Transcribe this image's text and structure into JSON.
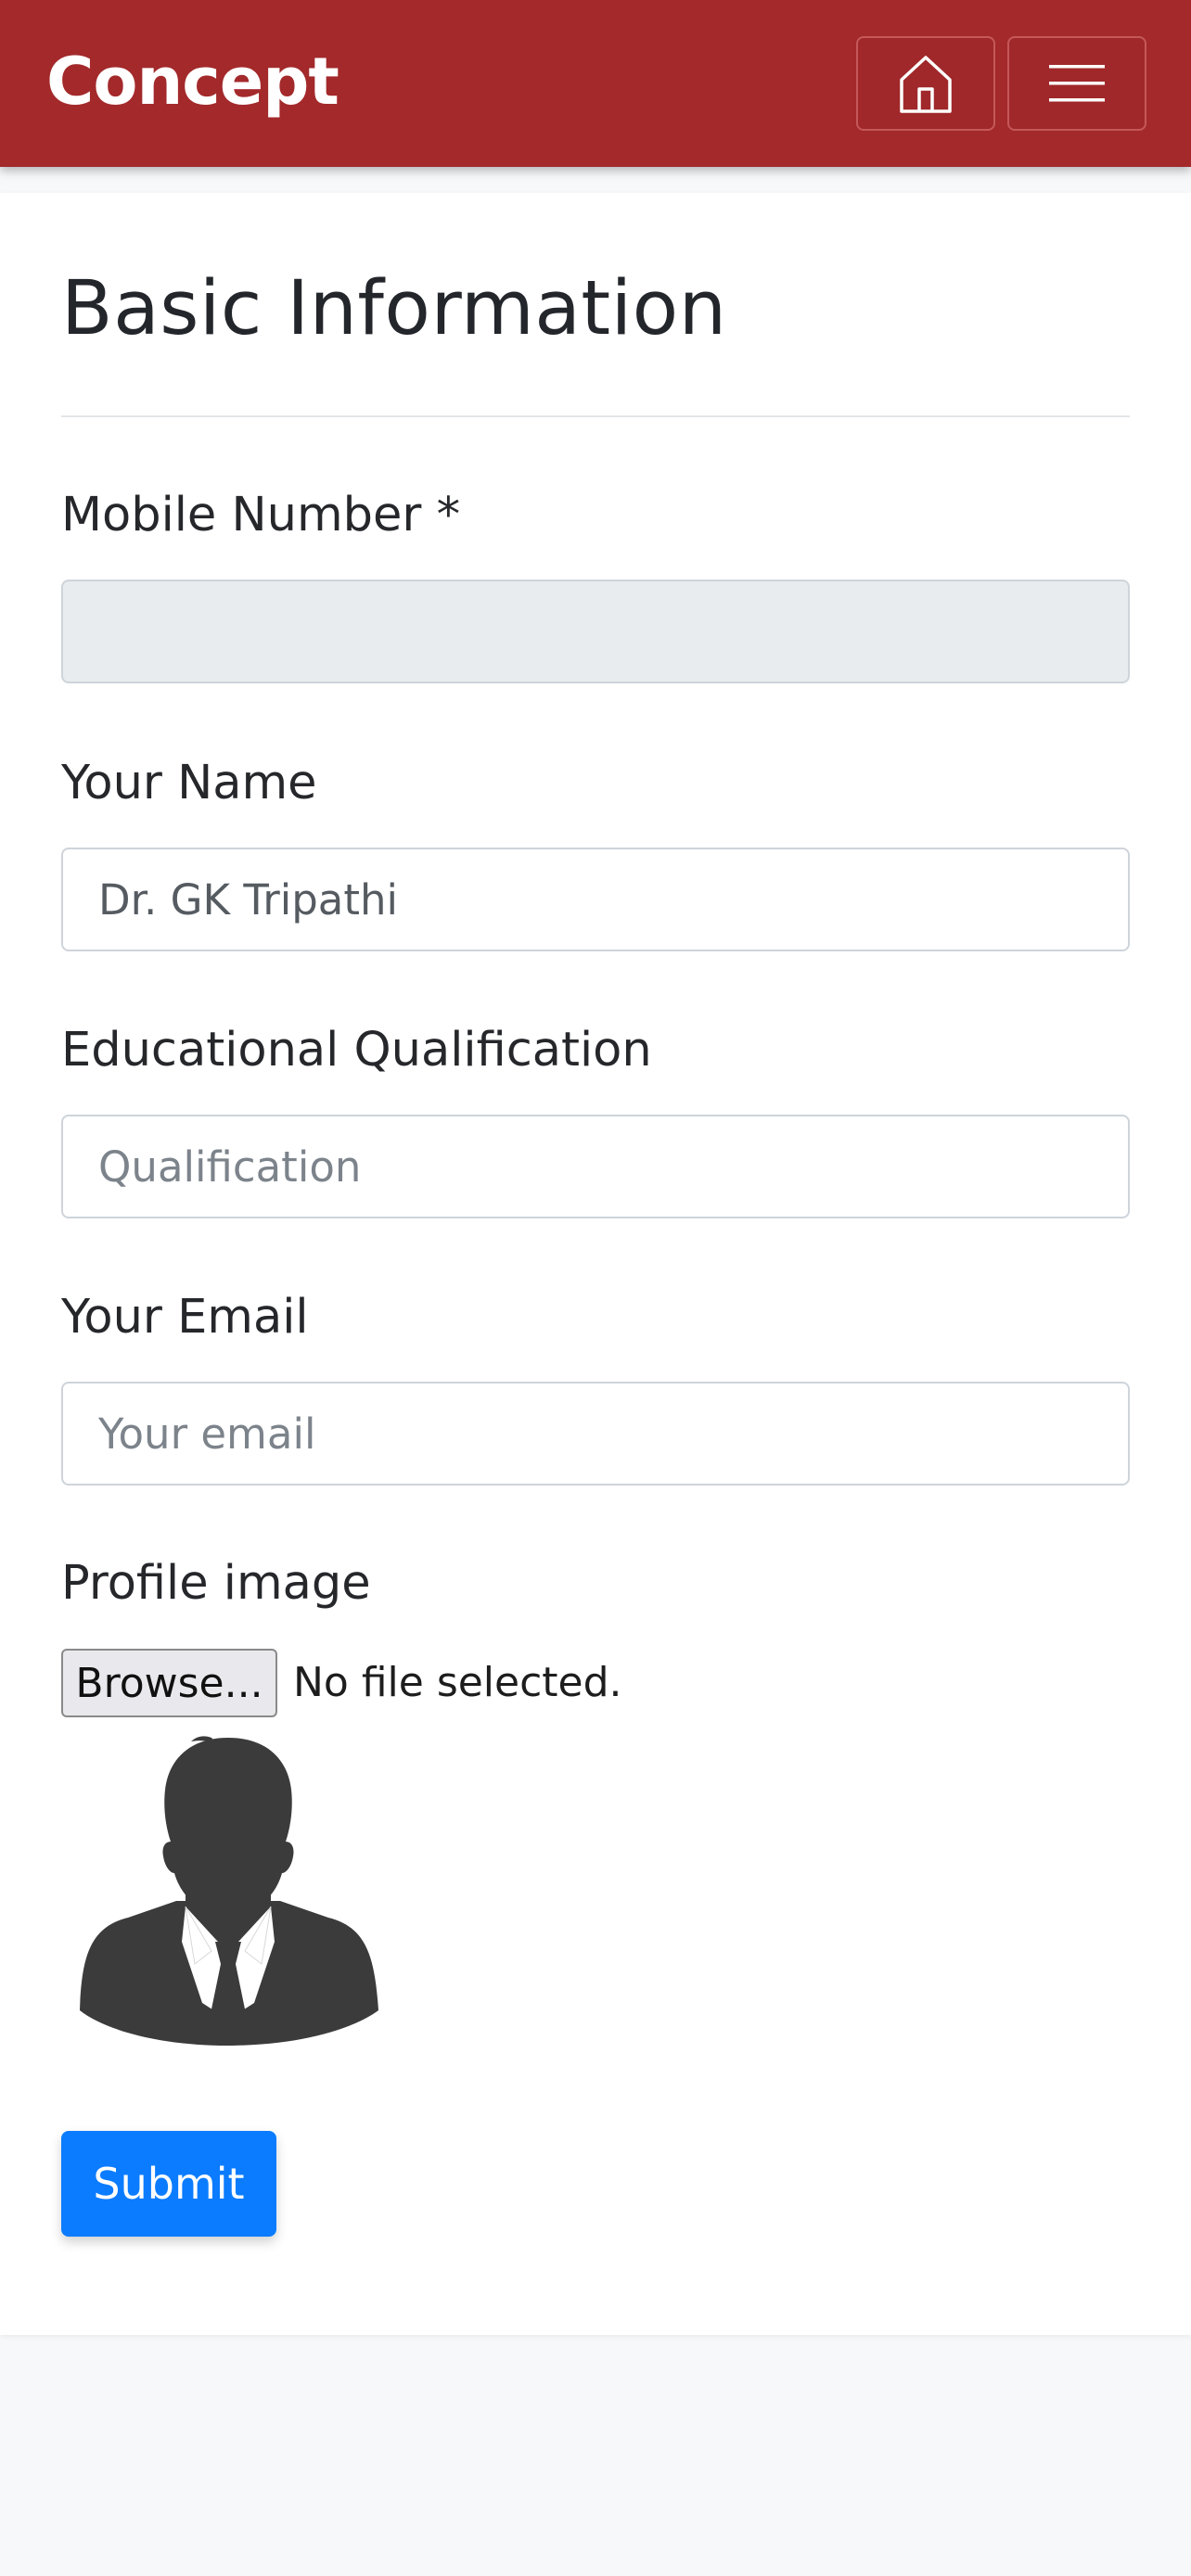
{
  "header": {
    "brand": "Concept",
    "home_icon": "home-icon",
    "menu_icon": "hamburger-menu-icon"
  },
  "form": {
    "title": "Basic Information",
    "mobile": {
      "label": "Mobile Number *",
      "value": ""
    },
    "name": {
      "label": "Your Name",
      "value": "Dr. GK Tripathi"
    },
    "qualification": {
      "label": "Educational Qualification",
      "placeholder": "Qualification",
      "value": ""
    },
    "email": {
      "label": "Your Email",
      "placeholder": "Your email",
      "value": ""
    },
    "profile_image": {
      "label": "Profile image",
      "browse_label": "Browse...",
      "status": "No file selected.",
      "preview_icon": "person-silhouette-icon"
    },
    "submit_label": "Submit"
  },
  "colors": {
    "header_bg": "#a3292b",
    "primary": "#0b7cff",
    "disabled_input_bg": "#e9ecef"
  }
}
